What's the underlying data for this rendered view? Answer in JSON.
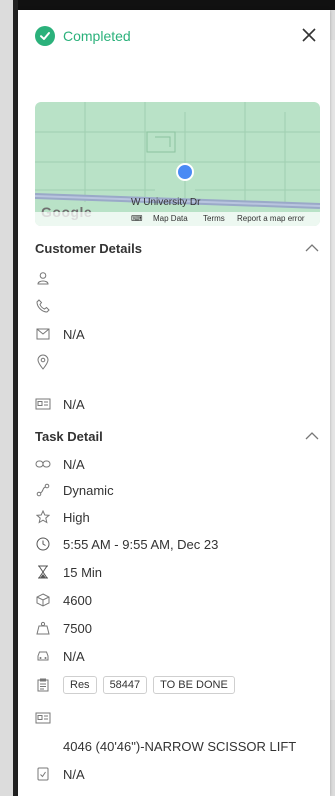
{
  "status": {
    "label": "Completed"
  },
  "map": {
    "road_label": "W University Dr",
    "logo_text": "Google",
    "footer": {
      "map_data": "Map Data",
      "terms": "Terms",
      "report": "Report a map error"
    }
  },
  "customer": {
    "title": "Customer Details",
    "email": "N/A",
    "extra": "N/A"
  },
  "task": {
    "title": "Task Detail",
    "link": "N/A",
    "type": "Dynamic",
    "priority": "High",
    "time": "5:55 AM - 9:55 AM, Dec 23",
    "duration": "15 Min",
    "volume": "4600",
    "weight": "7500",
    "vehicle": "N/A",
    "tags": [
      "Res",
      "58447",
      "TO BE DONE"
    ],
    "item": "4046 (40'46\")-NARROW SCISSOR LIFT",
    "checklist": "N/A"
  },
  "colors": {
    "success": "#2bb17b",
    "map_bg": "#b9e2c7",
    "pin": "#4a8af4"
  }
}
